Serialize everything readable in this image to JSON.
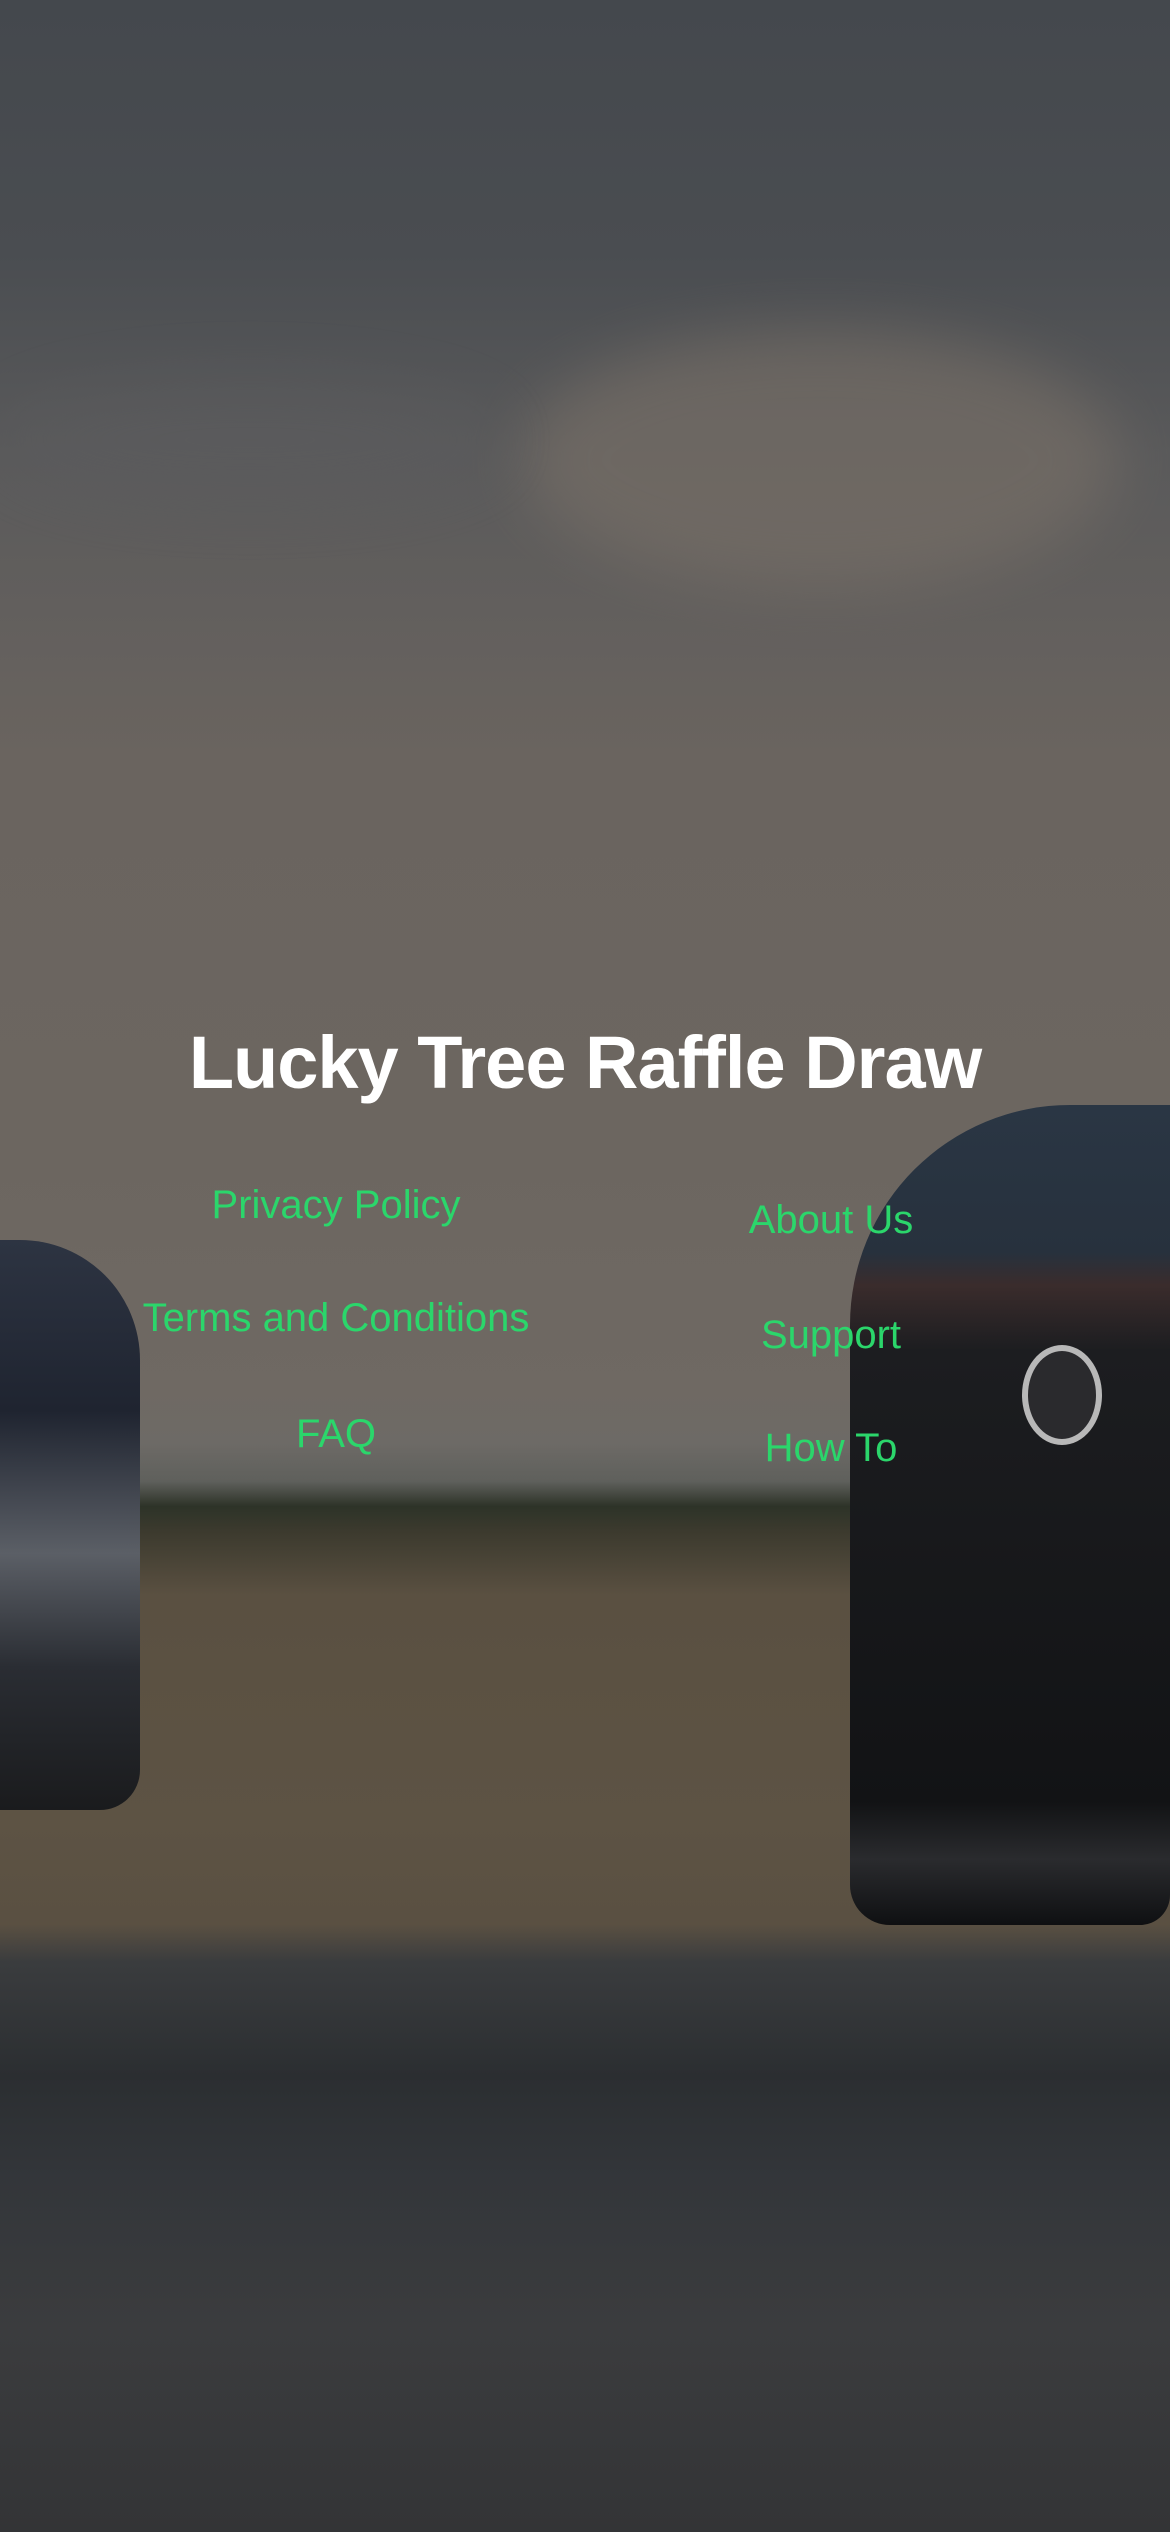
{
  "site_title": "Lucky Tree Raffle Draw",
  "links_left": [
    "Privacy Policy",
    "Terms and Conditions",
    "FAQ"
  ],
  "links_right": [
    "About Us",
    "Support",
    "How To"
  ],
  "colors": {
    "link": "#2bd66b",
    "title": "#ffffff"
  }
}
